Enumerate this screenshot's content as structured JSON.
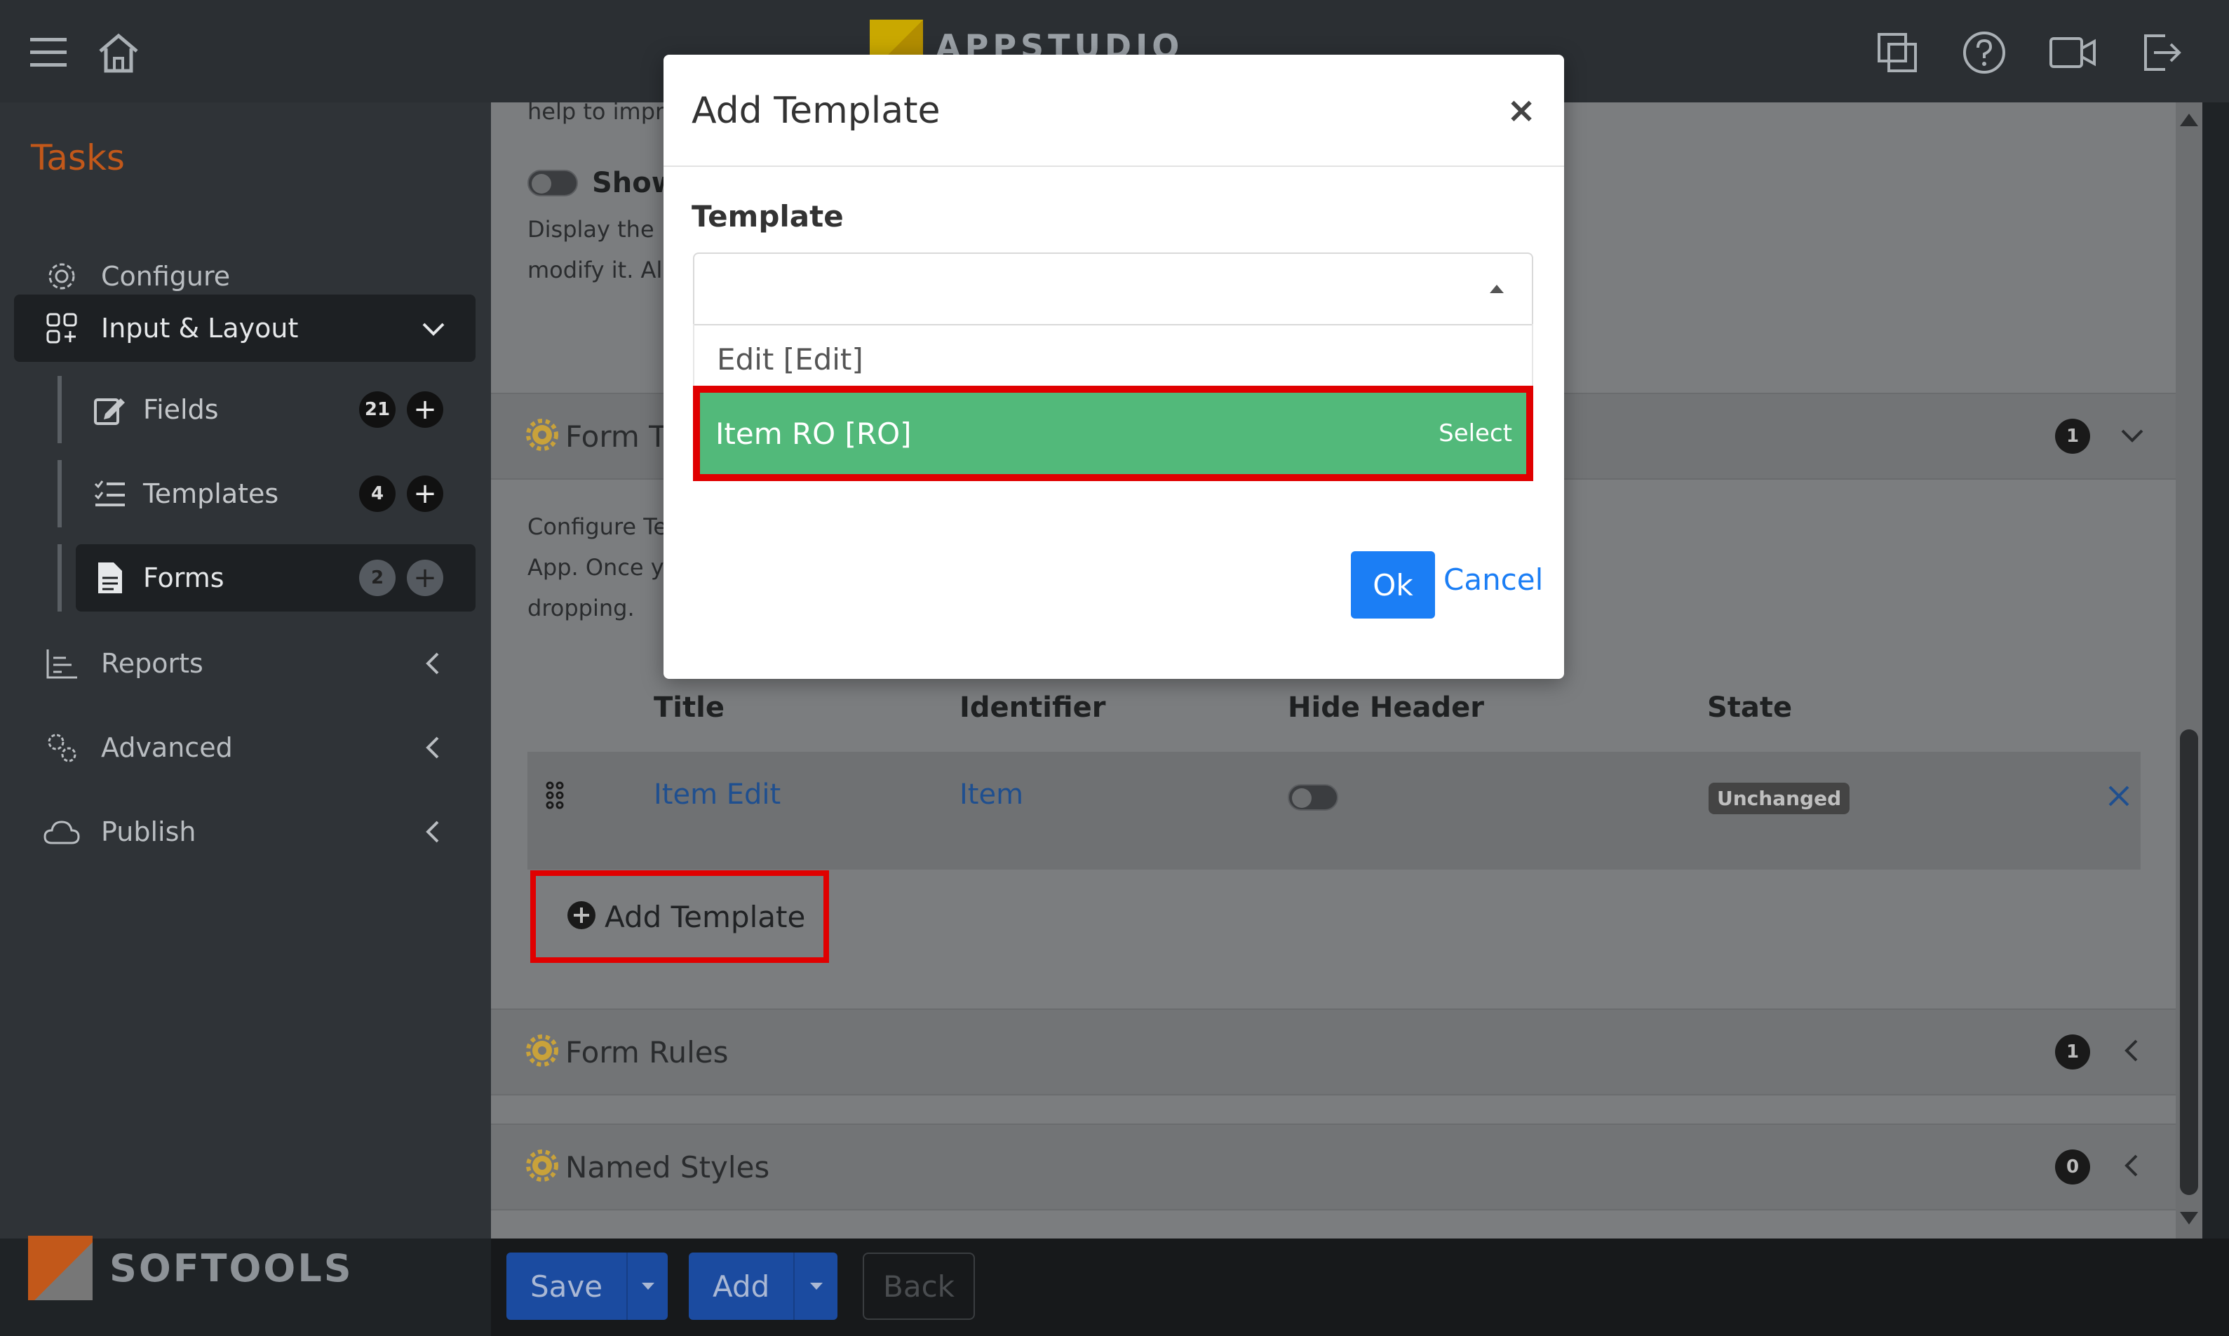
{
  "header": {
    "brand": "APPSTUDIO"
  },
  "sidebar": {
    "title": "Tasks",
    "items": [
      {
        "label": "Configure"
      },
      {
        "label": "Input & Layout"
      },
      {
        "label": "Reports"
      },
      {
        "label": "Advanced"
      },
      {
        "label": "Publish"
      }
    ],
    "subitems": [
      {
        "label": "Fields",
        "count": "21"
      },
      {
        "label": "Templates",
        "count": "4"
      },
      {
        "label": "Forms",
        "count": "2"
      }
    ],
    "footer_brand": "SOFTOOLS"
  },
  "content": {
    "frag_help": "help to impro",
    "frag_show": "Show",
    "frag_display1": "Display the F",
    "frag_display2": "modify it. All",
    "section_form_templates": "Form Te",
    "section_form_templates_count": "1",
    "frag_configure1": "Configure Te",
    "frag_configure2": "App. Once yo",
    "frag_configure3": "dropping.",
    "table": {
      "headers": [
        "Title",
        "Identifier",
        "Hide Header",
        "State"
      ],
      "rows": [
        {
          "title": "Item Edit",
          "identifier": "Item",
          "state": "Unchanged"
        }
      ]
    },
    "add_template": "Add Template",
    "section_form_rules": "Form Rules",
    "section_form_rules_count": "1",
    "section_named_styles": "Named Styles",
    "section_named_styles_count": "0"
  },
  "bottom": {
    "save": "Save",
    "add": "Add",
    "back": "Back"
  },
  "modal": {
    "title": "Add Template",
    "close": "×",
    "field_label": "Template",
    "options": [
      {
        "label": "Edit [Edit]"
      },
      {
        "label": "Item RO [RO]",
        "hint": "Select"
      }
    ],
    "ok": "Ok",
    "cancel": "Cancel"
  },
  "colors": {
    "accent": "#1b7ef5",
    "selected_option": "#52b97a",
    "highlight": "#e00000",
    "sidebar_title": "#c2581a"
  }
}
